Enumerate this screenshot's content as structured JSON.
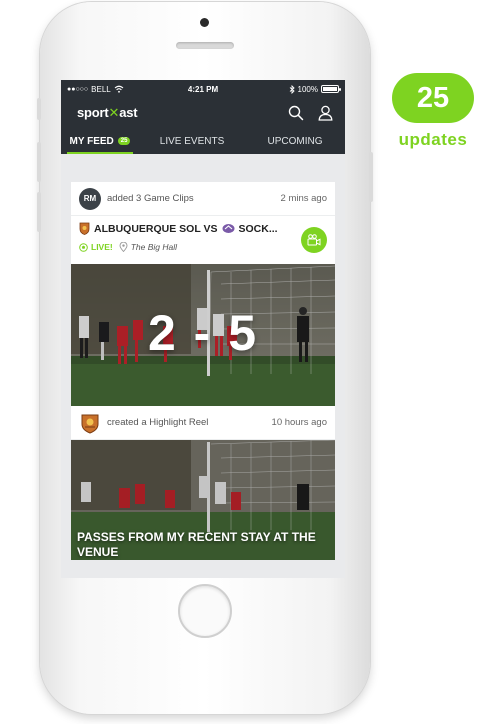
{
  "status_bar": {
    "carrier": "BELL",
    "time": "4:21 PM",
    "battery": "100%"
  },
  "app": {
    "logo_prefix": "sport",
    "logo_suffix": "ast"
  },
  "tabs": [
    {
      "label": "MY FEED",
      "badge": "25",
      "active": true
    },
    {
      "label": "LIVE EVENTS",
      "active": false
    },
    {
      "label": "UPCOMING",
      "active": false
    }
  ],
  "feed": [
    {
      "avatar_initials": "RM",
      "action": "added 3 Game Clips",
      "time": "2 mins ago",
      "match_title": "ALBUQUERQUE SOL VS",
      "match_title_rest": "SOCK...",
      "live_label": "LIVE!",
      "venue": "The Big Hall",
      "score": "2 - 5"
    },
    {
      "action": "created a Highlight Reel",
      "time": "10 hours ago",
      "caption": "PASSES FROM MY RECENT STAY AT THE VENUE"
    }
  ],
  "updates_badge": {
    "count": "25",
    "label": "updates"
  },
  "colors": {
    "accent": "#7ed321",
    "header": "#2b3036"
  }
}
